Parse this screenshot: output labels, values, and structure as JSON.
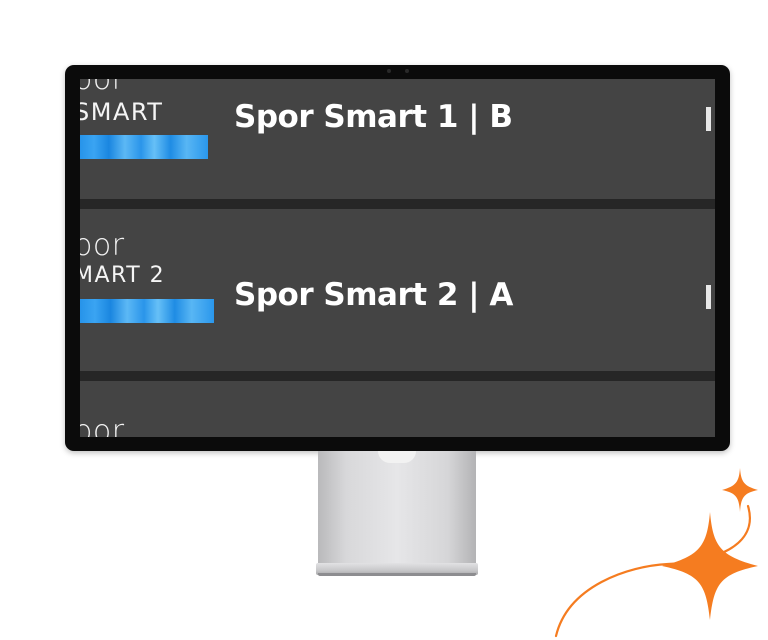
{
  "channels": [
    {
      "logo_top": "oor",
      "logo_bottom": "SMART",
      "title": "Spor Smart 1 | B"
    },
    {
      "logo_top": "oor",
      "logo_bottom": "MART 2",
      "title": "Spor Smart 2 | A"
    },
    {
      "logo_top": "oor"
    }
  ],
  "colors": {
    "row_bg": "#444444",
    "logo_bar": "#2a95ea",
    "sparkle": "#f57c20"
  },
  "icons": {
    "decoration": "sparkle-icon"
  }
}
